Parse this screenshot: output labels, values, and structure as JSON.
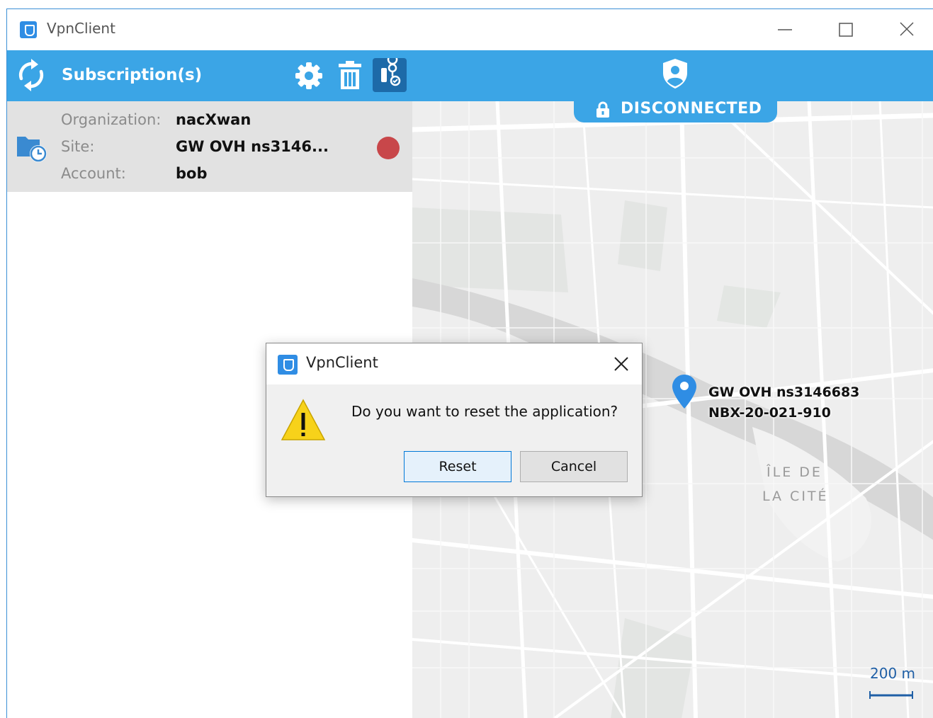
{
  "window": {
    "title": "VpnClient"
  },
  "toolbar": {
    "title": "Subscription(s)",
    "icons": [
      "sync-icon",
      "gear-icon",
      "trash-icon",
      "route-icon",
      "shield-user-icon"
    ]
  },
  "subscription": {
    "organization_label": "Organization:",
    "organization_value": "nacXwan",
    "site_label": "Site:",
    "site_value": "GW OVH ns3146...",
    "account_label": "Account:",
    "account_value": "bob",
    "status_color": "#c8474a"
  },
  "map": {
    "status_text": "DISCONNECTED",
    "pin_line1": "GW OVH ns3146683",
    "pin_line2": "NBX-20-021-910",
    "place_line1": "ÎLE DE",
    "place_line2": "LA CITÉ",
    "scale_label": "200 m"
  },
  "dialog": {
    "title": "VpnClient",
    "message": "Do you want to reset the application?",
    "reset_label": "Reset",
    "cancel_label": "Cancel"
  },
  "colors": {
    "accent": "#3ba5e6",
    "accent_dark": "#1d6aa8",
    "status_disconnected": "#c8474a",
    "pin": "#2f8de4"
  }
}
